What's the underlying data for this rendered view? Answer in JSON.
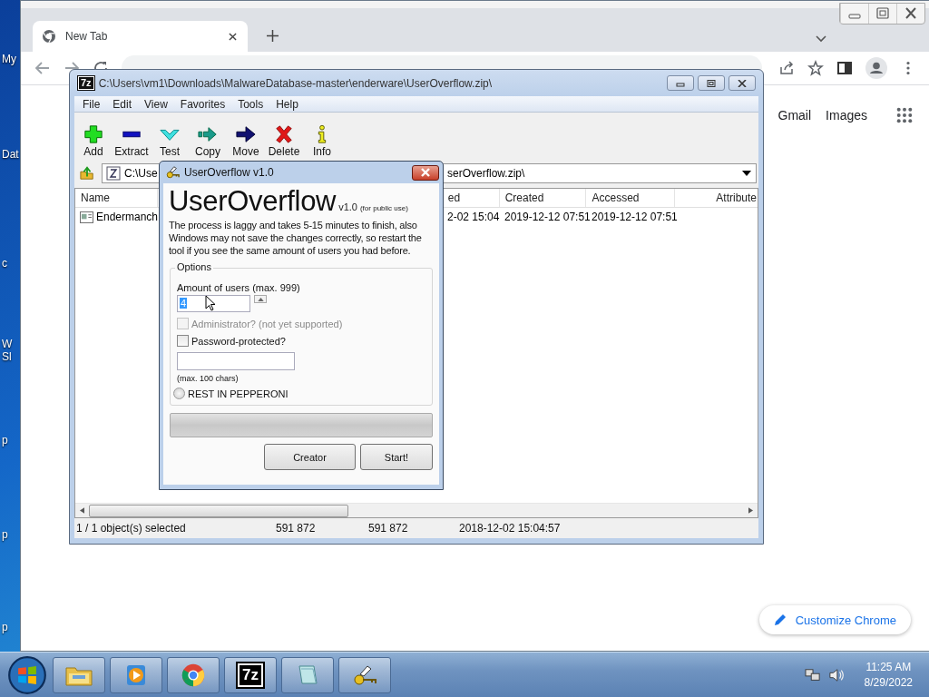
{
  "desktop_icons": [
    {
      "label": "My"
    },
    {
      "label": "Dat"
    },
    {
      "label": "c"
    },
    {
      "label": "W"
    },
    {
      "label": "Sl"
    },
    {
      "label": "p"
    },
    {
      "label": "p"
    },
    {
      "label": "p"
    }
  ],
  "browser": {
    "tabs": [
      {
        "label": "New Tab",
        "selected": true
      }
    ],
    "links": [
      "Gmail",
      "Images"
    ],
    "customize_button": "Customize Chrome"
  },
  "archive_window": {
    "logo": "7z",
    "title": "C:\\Users\\vm1\\Downloads\\MalwareDatabase-master\\enderware\\UserOverflow.zip\\",
    "menu": [
      "File",
      "Edit",
      "View",
      "Favorites",
      "Tools",
      "Help"
    ],
    "toolbar": [
      {
        "label": "Add",
        "kind": "add"
      },
      {
        "label": "Extract",
        "kind": "extract"
      },
      {
        "label": "Test",
        "kind": "test"
      },
      {
        "label": "Copy",
        "kind": "copy"
      },
      {
        "label": "Move",
        "kind": "move"
      },
      {
        "label": "Delete",
        "kind": "delete"
      },
      {
        "label": "Info",
        "kind": "info"
      }
    ],
    "address": [
      "C:\\Use",
      "serOverflow.zip\\"
    ],
    "columns": [
      "Name",
      "ed",
      "Created",
      "Accessed",
      "Attribute"
    ],
    "rows": [
      {
        "cells": [
          "Endermanch",
          "2-02 15:04",
          "2019-12-12 07:51",
          "2019-12-12 07:51"
        ]
      }
    ],
    "status": [
      "1 / 1 object(s) selected",
      "591 872",
      "591 872",
      "2018-12-02 15:04:57"
    ]
  },
  "dialog": {
    "title": "UserOverflow v1.0",
    "heading": "UserOverflow",
    "version": "v1.0",
    "tagline": "(for public use)",
    "description": "The process is laggy and takes 5-15 minutes to finish, also Windows may not save the changes correctly, so restart the tool if you see the same amount of users you had before.",
    "group_title": "Options",
    "users_label": "Amount of users (max. 999)",
    "users_value": "4",
    "checkboxes": [
      {
        "label": "Administrator? (not yet supported)",
        "checked": false,
        "disabled": true
      },
      {
        "label": "Password-protected?",
        "checked": false,
        "disabled": false
      }
    ],
    "password_hint": "(max. 100 chars)",
    "radio": {
      "label": "REST IN PEPPERONI",
      "selected": false
    },
    "progress": {
      "level": 0
    },
    "buttons": [
      "Creator",
      "Start!"
    ]
  },
  "taskbar": {
    "items": [
      {
        "kind": "explorer"
      },
      {
        "kind": "media"
      },
      {
        "kind": "chrome"
      },
      {
        "kind": "archiver",
        "label": "7z"
      },
      {
        "kind": "notepad"
      },
      {
        "kind": "keys"
      }
    ],
    "time": "11:25 AM",
    "date": "8/29/2022"
  }
}
